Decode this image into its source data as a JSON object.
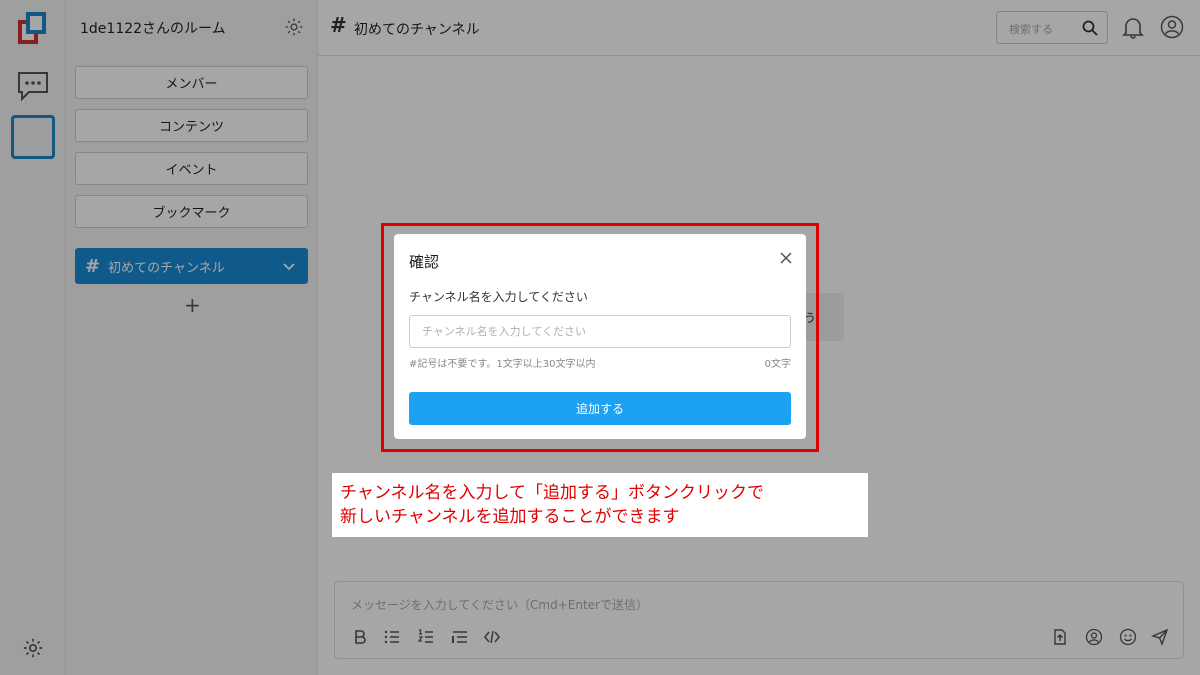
{
  "sidebar": {
    "room_name": "1de1122さんのルーム",
    "buttons": [
      "メンバー",
      "コンテンツ",
      "イベント",
      "ブックマーク"
    ],
    "channel": "初めてのチャンネル",
    "add_label": "+"
  },
  "header": {
    "hash": "#",
    "title": "初めてのチャンネル",
    "search_placeholder": "検索する"
  },
  "main": {
    "message_peek": "う",
    "composer_placeholder": "メッセージを入力してください（Cmd+Enterで送信）"
  },
  "dialog": {
    "title": "確認",
    "label": "チャンネル名を入力してください",
    "input_placeholder": "チャンネル名を入力してください",
    "input_value": "",
    "hint": "#記号は不要です。1文字以上30文字以内",
    "count": "0文字",
    "add_button": "追加する"
  },
  "annotation": {
    "line1": "チャンネル名を入力して「追加する」ボタンクリックで",
    "line2": "新しいチャンネルを追加することができます"
  },
  "colors": {
    "accent": "#1da1f2",
    "channel_active": "#1a8ad6",
    "annotation": "#e00000"
  }
}
